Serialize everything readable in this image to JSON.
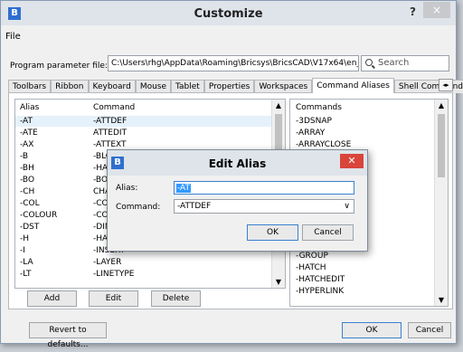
{
  "window": {
    "title": "Customize",
    "help_glyph": "?",
    "close_glyph": "×"
  },
  "menu": {
    "file": "File"
  },
  "param": {
    "label": "Program parameter file:",
    "value": "C:\\Users\\rhg\\AppData\\Roaming\\Bricsys\\BricsCAD\\V17x64\\en_US\\Su"
  },
  "search": {
    "placeholder": "Search"
  },
  "tabs": [
    "Toolbars",
    "Ribbon",
    "Keyboard",
    "Mouse",
    "Tablet",
    "Properties",
    "Workspaces",
    "Command Aliases",
    "Shell Commands"
  ],
  "alias_table": {
    "headers": {
      "alias": "Alias",
      "command": "Command"
    },
    "rows": [
      {
        "alias": "-AT",
        "command": "-ATTDEF"
      },
      {
        "alias": "-ATE",
        "command": "ATTEDIT"
      },
      {
        "alias": "-AX",
        "command": "-ATTEXT"
      },
      {
        "alias": "-B",
        "command": "-BLOC"
      },
      {
        "alias": "-BH",
        "command": "-HATC"
      },
      {
        "alias": "-BO",
        "command": "-BOUN"
      },
      {
        "alias": "-CH",
        "command": "CHAN"
      },
      {
        "alias": "-COL",
        "command": "-COLC"
      },
      {
        "alias": "-COLOUR",
        "command": "-COLC"
      },
      {
        "alias": "-DST",
        "command": "-DIMS"
      },
      {
        "alias": "-H",
        "command": "-HATC"
      },
      {
        "alias": "-I",
        "command": "-INSERT"
      },
      {
        "alias": "-LA",
        "command": "-LAYER"
      },
      {
        "alias": "-LT",
        "command": "-LINETYPE"
      }
    ]
  },
  "commands": {
    "header": "Commands",
    "items": [
      "-3DSNAP",
      "-ARRAY",
      "-ARRAYCLOSE",
      "-GROUP",
      "-HATCH",
      "-HATCHEDIT",
      "-HYPERLINK"
    ]
  },
  "buttons": {
    "add": "Add",
    "edit": "Edit",
    "delete": "Delete",
    "revert": "Revert to defaults...",
    "ok": "OK",
    "cancel": "Cancel"
  },
  "dialog": {
    "title": "Edit Alias",
    "alias_label": "Alias:",
    "alias_value": "-AT",
    "command_label": "Command:",
    "command_value": "-ATTDEF",
    "ok": "OK",
    "cancel": "Cancel"
  }
}
